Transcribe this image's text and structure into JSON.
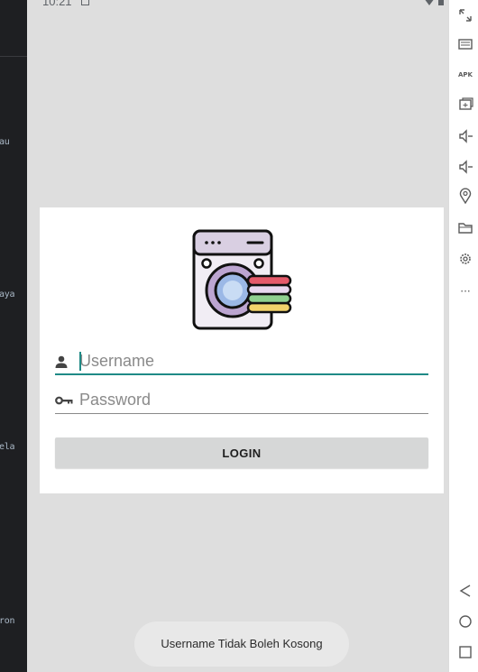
{
  "status_bar": {
    "time": "10:21"
  },
  "ide_code_fragments": [
    "au",
    "aya",
    "ela",
    "ron"
  ],
  "login": {
    "username_placeholder": "Username",
    "password_placeholder": "Password",
    "button_label": "LOGIN"
  },
  "toast": {
    "message": "Username Tidak Boleh Kosong"
  },
  "emulator_toolbar": {
    "apk_label": "APK",
    "more_label": "···"
  },
  "colors": {
    "accent": "#1f8a86",
    "card": "#ffffff",
    "screen_bg": "#dedede",
    "button_bg": "#d6d7d7"
  }
}
